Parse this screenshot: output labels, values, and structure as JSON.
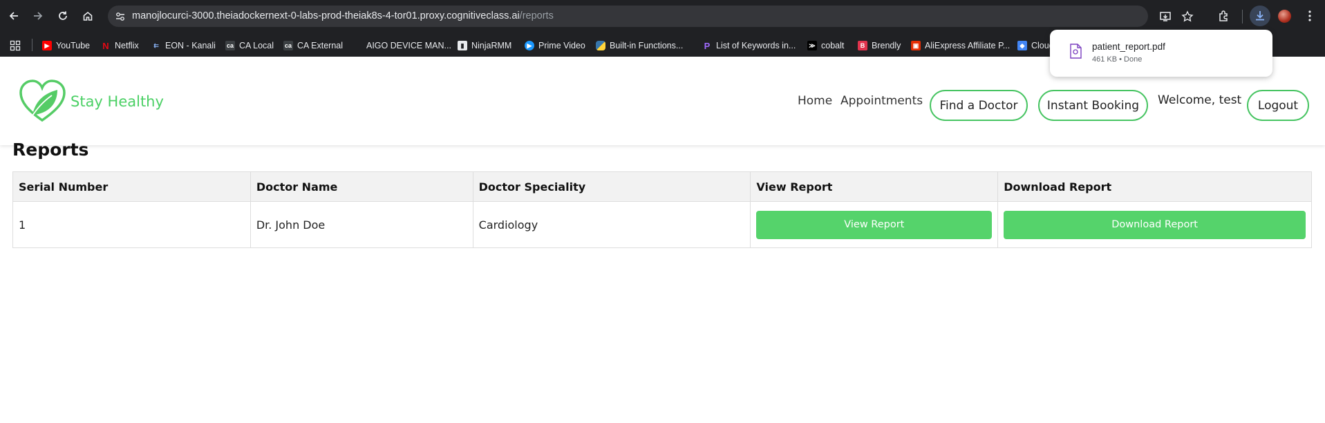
{
  "browser": {
    "url_host": "manojlocurci-3000.theiadockernext-0-labs-prod-theiak8s-4-tor01.proxy.cognitiveclass.ai",
    "url_path": "/reports",
    "icons": [
      "back-icon",
      "forward-icon",
      "reload-icon",
      "home-icon",
      "site-info-icon",
      "install-app-icon",
      "bookmark-star-icon",
      "extensions-icon",
      "download-icon",
      "profile-avatar",
      "menu-icon"
    ],
    "bookmarks": [
      {
        "label": "YouTube",
        "color": "#ff0000"
      },
      {
        "label": "Netflix",
        "color": "#e50914"
      },
      {
        "label": "EON - Kanali",
        "color": "#4a90d9"
      },
      {
        "label": "CA Local",
        "color": "#3c4043"
      },
      {
        "label": "CA External",
        "color": "#3c4043"
      },
      {
        "label": "AIGO DEVICE MAN...",
        "color": "#3c4043"
      },
      {
        "label": "NinjaRMM",
        "color": "#8ab4f8"
      },
      {
        "label": "Prime Video",
        "color": "#1a98ff"
      },
      {
        "label": "Built-in Functions...",
        "color": "#3776ab"
      },
      {
        "label": "List of Keywords in...",
        "color": "#6c2bd9"
      },
      {
        "label": "cobalt",
        "color": "#000000"
      },
      {
        "label": "Brendly",
        "color": "#e0334d"
      },
      {
        "label": "AliExpress Affiliate P...",
        "color": "#e62e04"
      },
      {
        "label": "Cloud",
        "color": "#4285f4"
      }
    ]
  },
  "download": {
    "filename": "patient_report.pdf",
    "meta": "461 KB • Done"
  },
  "app": {
    "brand": "Stay Healthy",
    "brand_color": "#4bd065",
    "nav": {
      "home": "Home",
      "appointments": "Appointments",
      "find_doctor": "Find a Doctor",
      "instant_booking": "Instant Booking",
      "welcome": "Welcome, test",
      "logout": "Logout"
    }
  },
  "reports": {
    "title": "Reports",
    "columns": [
      "Serial Number",
      "Doctor Name",
      "Doctor Speciality",
      "View Report",
      "Download Report"
    ],
    "rows": [
      {
        "serial": "1",
        "doctor": "Dr. John Doe",
        "speciality": "Cardiology",
        "view_label": "View Report",
        "download_label": "Download Report"
      }
    ],
    "button_color": "#55d36b"
  }
}
